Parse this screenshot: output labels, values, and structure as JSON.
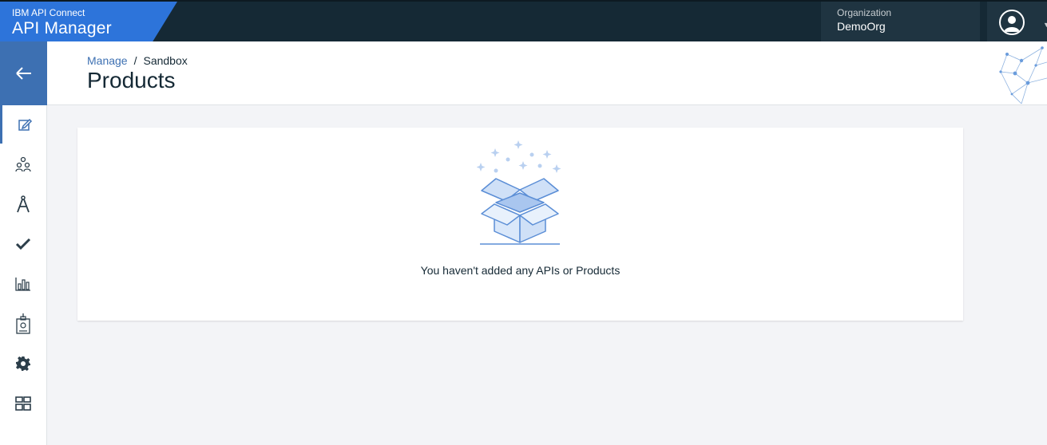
{
  "brand": {
    "small": "IBM API Connect",
    "title": "API Manager"
  },
  "org": {
    "label": "Organization",
    "value": "DemoOrg"
  },
  "nav": {
    "items": [
      {
        "name": "nav-develop",
        "icon": "edit-icon"
      },
      {
        "name": "nav-manage",
        "icon": "community-icon"
      },
      {
        "name": "nav-drafts",
        "icon": "compass-icon"
      },
      {
        "name": "nav-tasks",
        "icon": "checkmark-icon"
      },
      {
        "name": "nav-analytics",
        "icon": "bar-chart-icon"
      },
      {
        "name": "nav-members",
        "icon": "id-badge-icon"
      },
      {
        "name": "nav-settings",
        "icon": "gear-icon"
      },
      {
        "name": "nav-dashboard",
        "icon": "grid-icon"
      }
    ]
  },
  "breadcrumb": {
    "link": "Manage",
    "separator": "/",
    "current": "Sandbox"
  },
  "page": {
    "title": "Products"
  },
  "empty_state": {
    "message": "You haven't added any APIs or Products"
  },
  "colors": {
    "topbar": "#152935",
    "brand_blue": "#3d70b2",
    "org_bg": "#1f3441"
  }
}
